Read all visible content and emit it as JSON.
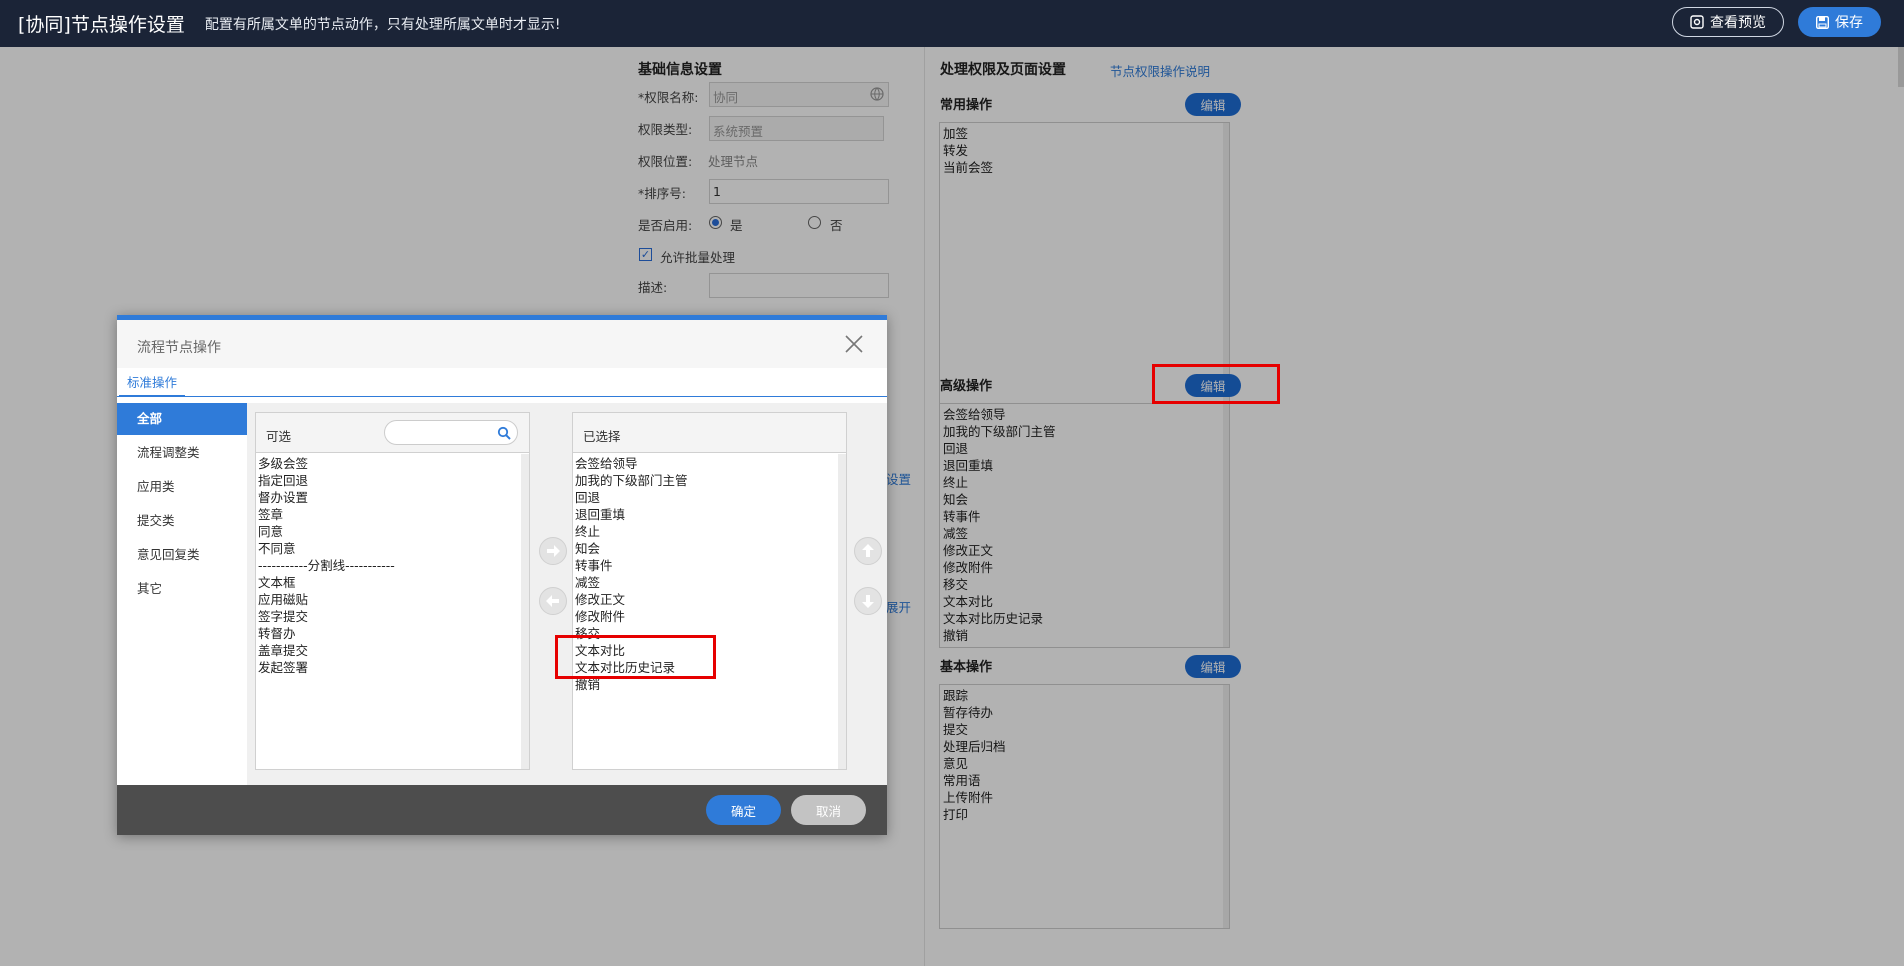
{
  "header": {
    "title": "[协同]节点操作设置",
    "subtitle": "配置有所属文单的节点动作，只有处理所属文单时才显示!",
    "preview_label": "查看预览",
    "save_label": "保存"
  },
  "basic_info": {
    "title": "基础信息设置",
    "name_label": "*权限名称:",
    "name_value": "协同",
    "type_label": "权限类型:",
    "type_value": "系统预置",
    "position_label": "权限位置:",
    "position_value": "处理节点",
    "order_label": "*排序号:",
    "order_value": "1",
    "enabled_label": "是否启用:",
    "enabled_yes": "是",
    "enabled_no": "否",
    "batch_label": "允许批量处理",
    "desc_label": "描述:",
    "partial_link_1": "设置",
    "partial_link_2": "展开"
  },
  "permissions": {
    "title": "处理权限及页面设置",
    "help_link": "节点权限操作说明",
    "edit_label": "编辑",
    "common_title": "常用操作",
    "common_items": [
      "加签",
      "转发",
      "当前会签"
    ],
    "advanced_title": "高级操作",
    "advanced_items": [
      "会签给领导",
      "加我的下级部门主管",
      "回退",
      "退回重填",
      "终止",
      "知会",
      "转事件",
      "减签",
      "修改正文",
      "修改附件",
      "移交",
      "文本对比",
      "文本对比历史记录",
      "撤销"
    ],
    "basic_title": "基本操作",
    "basic_items": [
      "跟踪",
      "暂存待办",
      "提交",
      "处理后归档",
      "意见",
      "常用语",
      "上传附件",
      "打印"
    ]
  },
  "dialog": {
    "title": "流程节点操作",
    "tab_label": "标准操作",
    "nav": [
      "全部",
      "流程调整类",
      "应用类",
      "提交类",
      "意见回复类",
      "其它"
    ],
    "available_title": "可选",
    "available_items": [
      "多级会签",
      "指定回退",
      "督办设置",
      "签章",
      "同意",
      "不同意",
      "-----------分割线-----------",
      "文本框",
      "应用磁贴",
      "签字提交",
      "转督办",
      "盖章提交",
      "发起签署"
    ],
    "selected_title": "已选择",
    "selected_items": [
      "会签给领导",
      "加我的下级部门主管",
      "回退",
      "退回重填",
      "终止",
      "知会",
      "转事件",
      "减签",
      "修改正文",
      "修改附件",
      "移交",
      "文本对比",
      "文本对比历史记录",
      "撤销"
    ],
    "ok_label": "确定",
    "cancel_label": "取消"
  },
  "colors": {
    "topbar": "#1b2437",
    "accent": "#2f7bd9",
    "highlight": "#e60000"
  }
}
